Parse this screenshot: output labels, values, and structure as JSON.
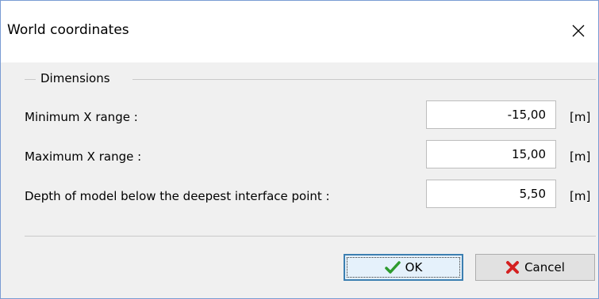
{
  "window": {
    "title": "World coordinates"
  },
  "group": {
    "legend": "Dimensions"
  },
  "fields": [
    {
      "label": "Minimum X range :",
      "value": "-15,00",
      "unit": "[m]"
    },
    {
      "label": "Maximum X range :",
      "value": "15,00",
      "unit": "[m]"
    },
    {
      "label": "Depth of model below the deepest interface point :",
      "value": "5,50",
      "unit": "[m]"
    }
  ],
  "buttons": {
    "ok_label": "OK",
    "cancel_label": "Cancel"
  },
  "icons": {
    "close": "close-icon",
    "ok": "checkmark-icon",
    "cancel": "x-icon"
  },
  "colors": {
    "ok_icon": "#2e9b2e",
    "cancel_icon": "#d42020",
    "focus_border": "#3c7fb1"
  }
}
